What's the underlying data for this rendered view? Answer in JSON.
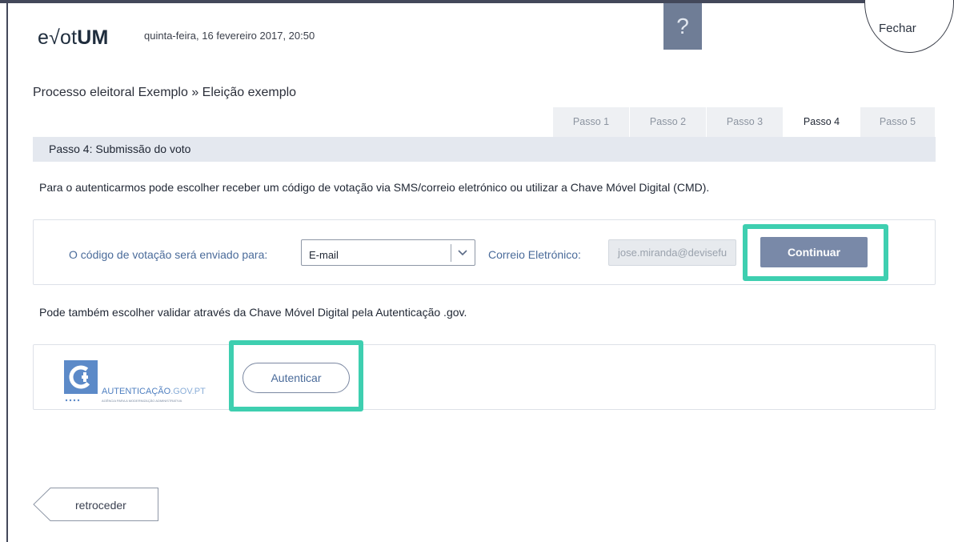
{
  "header": {
    "logo_prefix": "e√ot",
    "logo_bold": "UM",
    "datetime": "quinta-feira, 16 fevereiro 2017, 20:50",
    "help_label": "?",
    "close_label": "Fechar"
  },
  "breadcrumb": "Processo eleitoral Exemplo » Eleição exemplo",
  "tabs": [
    {
      "label": "Passo 1",
      "active": false
    },
    {
      "label": "Passo 2",
      "active": false
    },
    {
      "label": "Passo 3",
      "active": false
    },
    {
      "label": "Passo 4",
      "active": true
    },
    {
      "label": "Passo 5",
      "active": false
    }
  ],
  "step_header": "Passo 4: Submissão do voto",
  "intro": "Para o autenticarmos pode escolher receber um código de votação via SMS/correio eletrónico ou utilizar a Chave Móvel Digital (CMD).",
  "code_panel": {
    "send_label": "O código de votação será enviado para:",
    "select_value": "E-mail",
    "email_label": "Correio Eletrónico:",
    "email_value": "jose.miranda@devisefu",
    "continue_label": "Continuar"
  },
  "alt_text": "Pode também escolher validar através da Chave Móvel Digital pela Autenticação .gov.",
  "auth_panel": {
    "logo_text_main": "AUTENTICAÇÃO",
    "logo_text_suffix": ".GOV.PT",
    "logo_subtitle": "AGÊNCIA PARA A MODERNIZAÇÃO ADMINISTRATIVA",
    "button_label": "Autenticar"
  },
  "back_label": "retroceder",
  "colors": {
    "accent": "#7989a8",
    "highlight": "#3ecfb0",
    "step_header_bg": "#e4e8ef",
    "label_blue": "#4a6b9a"
  }
}
